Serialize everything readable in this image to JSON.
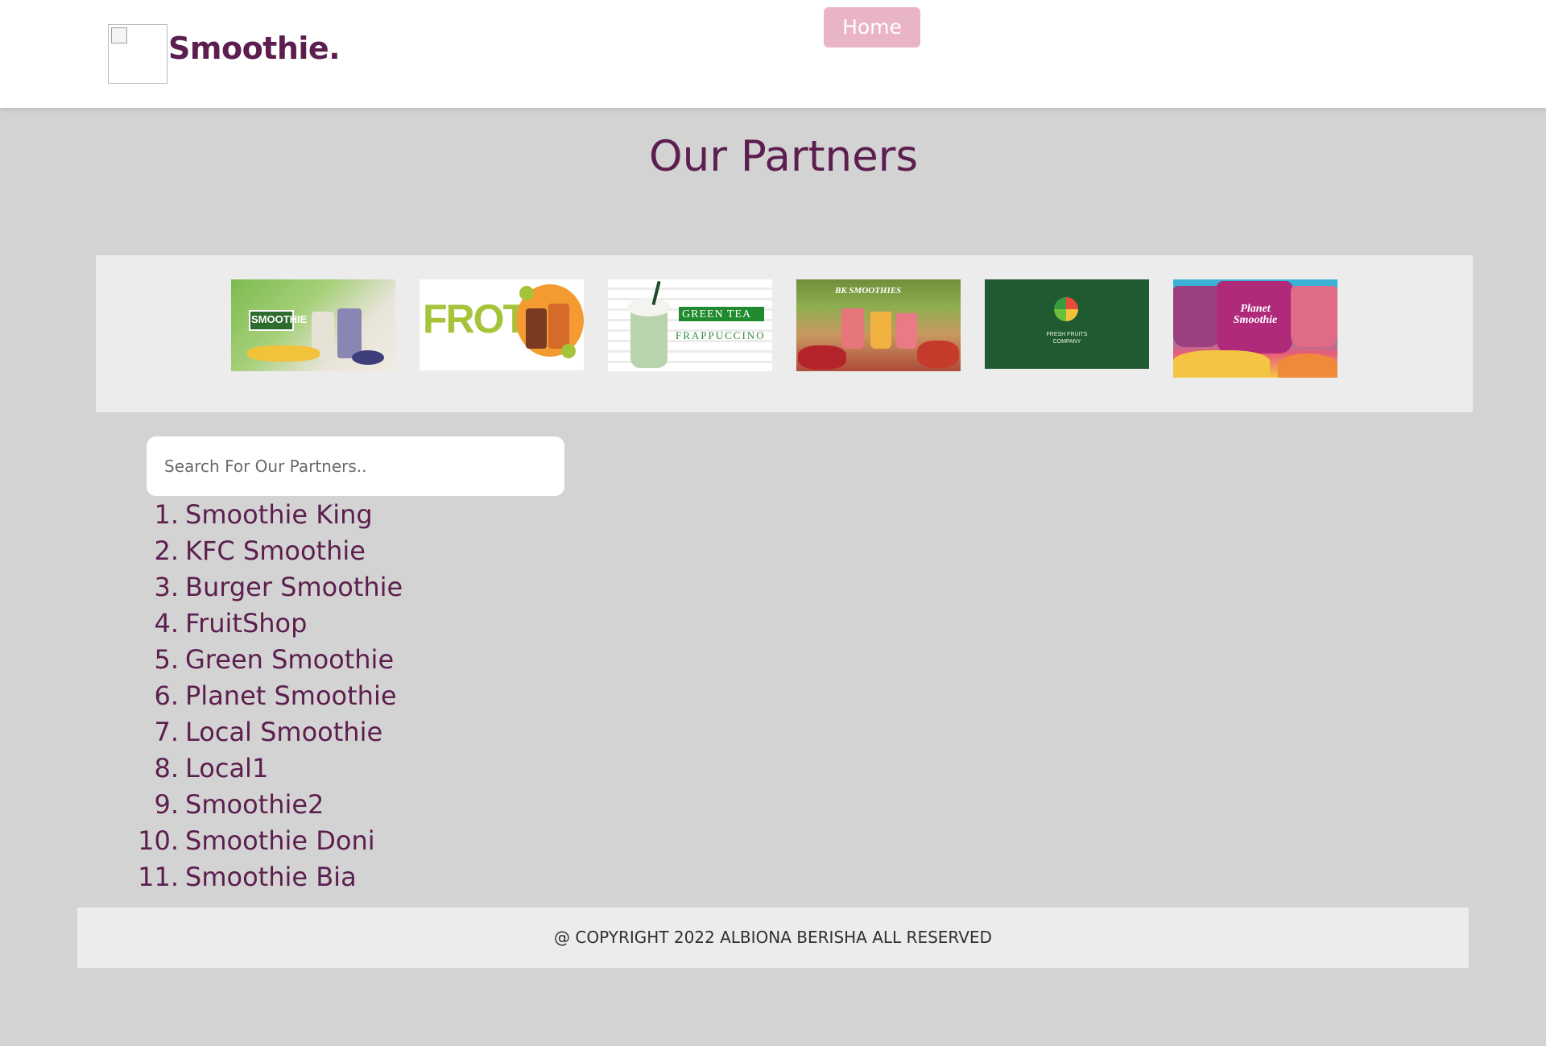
{
  "header": {
    "logo_alt": "",
    "brand": "Smoothie.",
    "nav": {
      "home_label": "Home"
    }
  },
  "main": {
    "title": "Our Partners",
    "partner_images": [
      {
        "name": "kfc-smoothie-image",
        "overlay_text": "SMOOTHIE"
      },
      {
        "name": "frotea-image",
        "overlay_text": "FROTEA"
      },
      {
        "name": "green-tea-frappuccino-image",
        "overlay_text": "GREEN TEA",
        "overlay_text_2": "FRAPPUCCINO"
      },
      {
        "name": "bk-smoothies-image",
        "overlay_text": "BK SMOOTHIES"
      },
      {
        "name": "fresh-fruits-company-image",
        "overlay_text": "FRESH FRUITS COMPANY"
      },
      {
        "name": "planet-smoothie-image",
        "overlay_text": "Planet Smoothie"
      }
    ],
    "search": {
      "placeholder": "Search For Our Partners.."
    },
    "partners": [
      {
        "num": "1.",
        "name": "Smoothie King"
      },
      {
        "num": "2.",
        "name": "KFC Smoothie"
      },
      {
        "num": "3.",
        "name": "Burger Smoothie"
      },
      {
        "num": "4.",
        "name": "FruitShop"
      },
      {
        "num": "5.",
        "name": "Green Smoothie"
      },
      {
        "num": "6.",
        "name": "Planet Smoothie"
      },
      {
        "num": "7.",
        "name": "Local Smoothie"
      },
      {
        "num": "8.",
        "name": "Local1"
      },
      {
        "num": "9.",
        "name": "Smoothie2"
      },
      {
        "num": "10.",
        "name": "Smoothie Doni"
      },
      {
        "num": "11.",
        "name": "Smoothie Bia"
      }
    ]
  },
  "footer": {
    "copyright": "@ COPYRIGHT 2022 ALBIONA BERISHA ALL RESERVED"
  },
  "colors": {
    "brand": "#5c1e4f",
    "nav_button": "#e9b3c8",
    "page_background": "#d3d3d3",
    "strip_background": "#ececec"
  }
}
